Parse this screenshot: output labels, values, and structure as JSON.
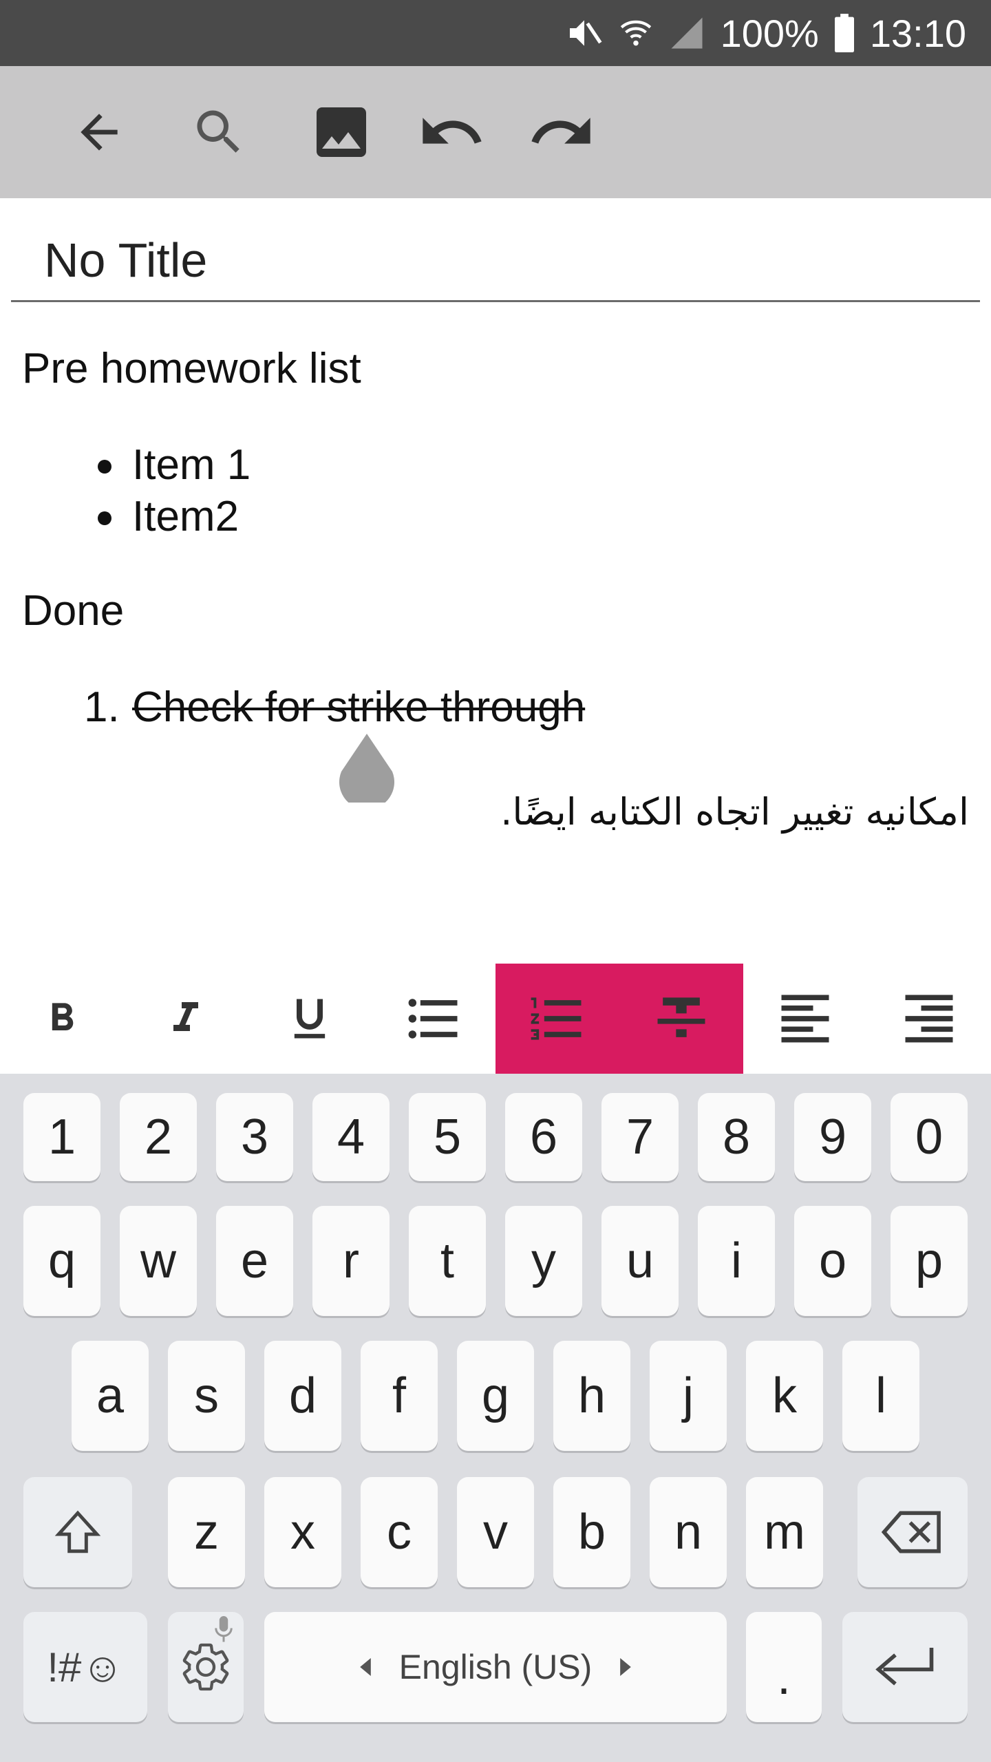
{
  "status_bar": {
    "battery": "100%",
    "time": "13:10",
    "icons": [
      "mute-icon",
      "wifi-icon",
      "signal-icon",
      "battery-icon"
    ]
  },
  "toolbar": {
    "icons": [
      "back-arrow-icon",
      "search-icon",
      "image-icon",
      "undo-icon",
      "redo-icon"
    ]
  },
  "note": {
    "title": "No Title",
    "heading1": "Pre homework list",
    "bullets": [
      "Item 1",
      "Item2"
    ],
    "heading2": "Done",
    "numbered": [
      {
        "num": "1.",
        "text": "Check for strike through"
      }
    ],
    "rtl_text": "امكانيه تغيير اتجاه الكتابه ايضًا."
  },
  "format_bar": {
    "buttons": [
      "bold",
      "italic",
      "underline",
      "bullet-list",
      "numbered-list",
      "strikethrough",
      "align-left",
      "align-right"
    ],
    "active": [
      "numbered-list",
      "strikethrough"
    ],
    "accent": "#d81b60"
  },
  "keyboard": {
    "row_numbers": [
      "1",
      "2",
      "3",
      "4",
      "5",
      "6",
      "7",
      "8",
      "9",
      "0"
    ],
    "row1": [
      "q",
      "w",
      "e",
      "r",
      "t",
      "y",
      "u",
      "i",
      "o",
      "p"
    ],
    "row2": [
      "a",
      "s",
      "d",
      "f",
      "g",
      "h",
      "j",
      "k",
      "l"
    ],
    "row3": [
      "z",
      "x",
      "c",
      "v",
      "b",
      "n",
      "m"
    ],
    "symbols_label": "!#☺",
    "space_label": "English (US)",
    "period_label": "."
  }
}
